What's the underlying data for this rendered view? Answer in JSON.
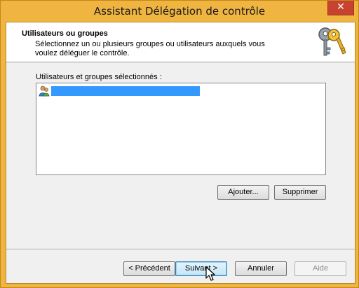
{
  "window": {
    "title": "Assistant Délégation de contrôle",
    "close_glyph": "✕"
  },
  "header": {
    "title": "Utilisateurs ou groupes",
    "description": "Sélectionnez un ou plusieurs groupes ou utilisateurs auxquels vous voulez déléguer le contrôle.",
    "icon": "keys-icon"
  },
  "selection": {
    "label": "Utilisateurs et groupes sélectionnés :",
    "items": [
      {
        "icon": "user-icon",
        "selected": true
      }
    ]
  },
  "list_buttons": {
    "add": "Ajouter...",
    "remove": "Supprimer"
  },
  "footer": {
    "prev": "< Précédent",
    "next": "Suivant >",
    "cancel": "Annuler",
    "help": "Aide"
  },
  "colors": {
    "frame": "#f0b440",
    "close": "#c7432f",
    "selection": "#3399ff",
    "focus_button": "#c4e5f6"
  }
}
